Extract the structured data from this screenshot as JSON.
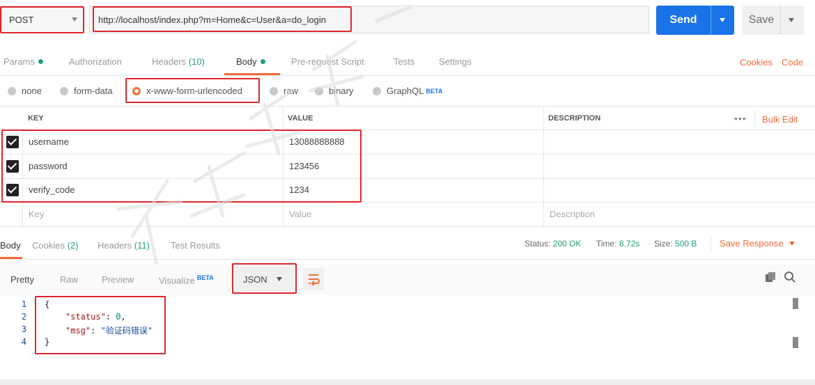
{
  "request": {
    "method": "POST",
    "url": "http://localhost/index.php?m=Home&c=User&a=do_login",
    "send_label": "Send",
    "save_label": "Save"
  },
  "tabs": {
    "params": "Params",
    "authorization": "Authorization",
    "headers": "Headers",
    "headers_count": "(10)",
    "body": "Body",
    "prerequest": "Pre-request Script",
    "tests": "Tests",
    "settings": "Settings",
    "cookies": "Cookies",
    "code": "Code"
  },
  "body_types": {
    "none": "none",
    "form_data": "form-data",
    "urlencoded": "x-www-form-urlencoded",
    "raw": "raw",
    "binary": "binary",
    "graphql": "GraphQL",
    "beta": "BETA"
  },
  "params_table": {
    "headers": {
      "key": "KEY",
      "value": "VALUE",
      "description": "DESCRIPTION",
      "dots": "•••",
      "bulk_edit": "Bulk Edit"
    },
    "rows": [
      {
        "key": "username",
        "value": "13088888888",
        "checked": true
      },
      {
        "key": "password",
        "value": "123456",
        "checked": true
      },
      {
        "key": "verify_code",
        "value": "1234",
        "checked": true
      }
    ],
    "placeholder": {
      "key": "Key",
      "value": "Value",
      "description": "Description"
    }
  },
  "response": {
    "tabs": {
      "body": "Body",
      "cookies": "Cookies",
      "cookies_count": "(2)",
      "headers": "Headers",
      "headers_count": "(11)",
      "test_results": "Test Results"
    },
    "status_label": "Status:",
    "status_value": "200 OK",
    "time_label": "Time:",
    "time_value": "8.72s",
    "size_label": "Size:",
    "size_value": "500 B",
    "save_response": "Save Response",
    "viewer": {
      "pretty": "Pretty",
      "raw": "Raw",
      "preview": "Preview",
      "visualize": "Visualize",
      "beta": "BETA",
      "format": "JSON"
    },
    "code": {
      "line_numbers": [
        "1",
        "2",
        "3",
        "4"
      ],
      "open_brace": "{",
      "status_key": "\"status\"",
      "status_value": "0",
      "msg_key": "\"msg\"",
      "msg_value": "\"验证码错误\"",
      "close_brace": "}",
      "colon": ": ",
      "comma": ","
    }
  },
  "colors": {
    "accent": "#f26b3a",
    "send": "#1a73e8",
    "success": "#22a06b",
    "highlight_box": "#e0262b"
  }
}
